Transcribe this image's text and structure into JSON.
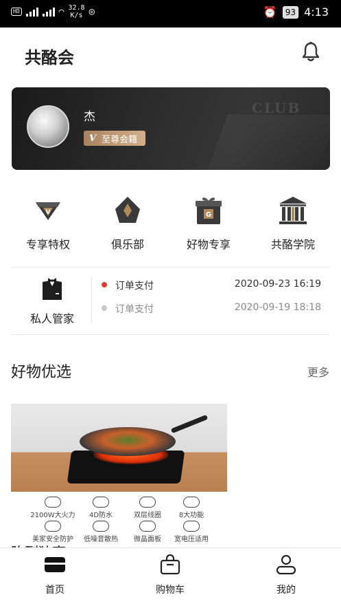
{
  "status_bar": {
    "left_text": "HD 4G 4G",
    "speed_value": "32.8",
    "speed_unit": "K/s",
    "battery": "93",
    "time": "4:13"
  },
  "header": {
    "title": "共酪会"
  },
  "member_card": {
    "name": "杰",
    "badge_label": "至尊会籍",
    "badge_mark": "V",
    "bg_text": "CLUB"
  },
  "quick_menu": [
    {
      "label": "专享特权",
      "icon": "diamond-v-icon"
    },
    {
      "label": "俱乐部",
      "icon": "club-diamond-icon"
    },
    {
      "label": "好物专享",
      "icon": "gift-box-icon"
    },
    {
      "label": "共酪学院",
      "icon": "academy-building-icon"
    }
  ],
  "butler": {
    "label": "私人管家",
    "icon": "butler-tuxedo-icon"
  },
  "orders": [
    {
      "title": "订单支付",
      "time": "2020-09-23 16:19",
      "color": "#e53935"
    },
    {
      "title": "订单支付",
      "time": "2020-09-19 18:18",
      "color": "#c8c8c8"
    }
  ],
  "section": {
    "title": "好物优选",
    "more": "更多"
  },
  "product": {
    "features": [
      "2100W大火力",
      "4D防水",
      "双层线圈",
      "8大功能",
      "美家安全防护",
      "低噪音散热",
      "微晶面板",
      "宽电压适用"
    ],
    "title": "陈列独享"
  },
  "bottom_nav": [
    {
      "label": "首页",
      "icon": "home-card-icon"
    },
    {
      "label": "购物车",
      "icon": "shopping-bag-icon"
    },
    {
      "label": "我的",
      "icon": "user-icon"
    }
  ]
}
